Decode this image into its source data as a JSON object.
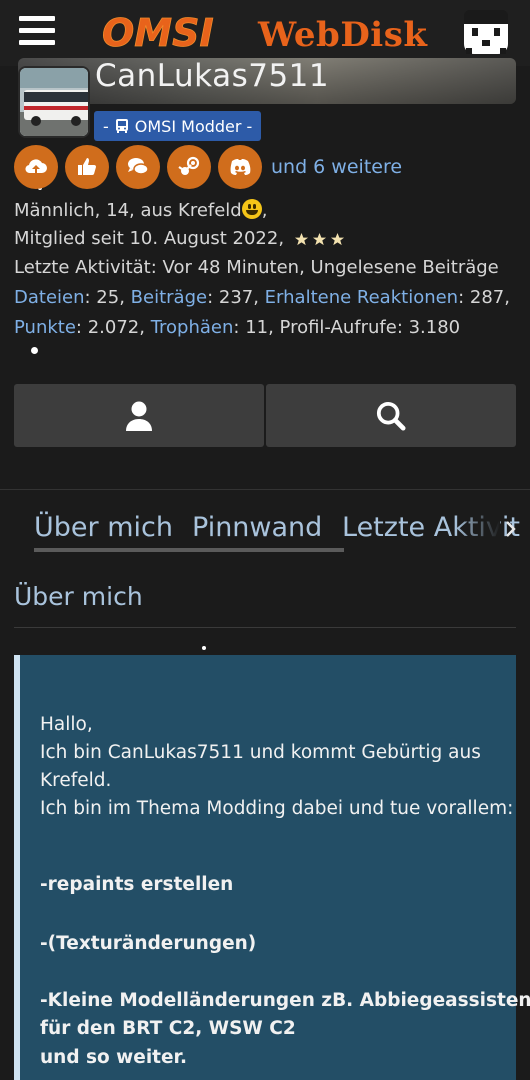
{
  "header": {
    "logo_text_a": "OMSI",
    "logo_text_b": "WebDisk",
    "menu_icon": "hamburger-icon",
    "user_icon": "user-menu-icon"
  },
  "profile": {
    "username": "CanLukas7511",
    "rank": "OMSI Modder",
    "more_trophies": "und 6 weitere",
    "trophy_icons": [
      "upload-icon",
      "thumbs-up-icon",
      "comments-icon",
      "steam-icon",
      "discord-icon"
    ],
    "line1": "Männlich, 14, aus Krefeld",
    "line1_end": ",",
    "member_since": "Mitglied seit 10. August 2022,",
    "last_activity": "Letzte Aktivität: Vor 48 Minuten, Ungelesene Beiträge",
    "stats_row1": {
      "files_label": "Dateien",
      "files_value": ": 25, ",
      "posts_label": "Beiträge",
      "posts_value": ": 237, ",
      "reactions_label": "Erhaltene Reaktionen",
      "reactions_value": ": 287,"
    },
    "stats_row2": {
      "points_label": "Punkte",
      "points_value": ": 2.072, ",
      "trophies_label": "Trophäen",
      "trophies_value": ": 11, Profil-Aufrufe: 3.180"
    }
  },
  "actions": {
    "follow_icon": "user-icon",
    "search_icon": "search-icon"
  },
  "tabs": [
    {
      "label": "Über mich"
    },
    {
      "label": "Pinnwand"
    },
    {
      "label": "Letzte Aktivit"
    }
  ],
  "section": {
    "title": "Über mich"
  },
  "about": {
    "lines": [
      "Hallo,",
      "Ich bin CanLukas7511 und kommt Gebürtig aus",
      "Krefeld.",
      "Ich bin im Thema Modding dabei und tue vorallem:",
      "-repaints erstellen",
      "-(Texturänderungen)",
      "-Kleine Modelländerungen zB. Abbiegeassistent",
      "für den BRT C2, WSW C2",
      "und so weiter."
    ]
  },
  "colors": {
    "background": "#1b1b1b",
    "badge": "#d06d1c",
    "link": "#7fb0e6",
    "rank_badge": "#2d5ba8",
    "about_bg": "#234e66"
  }
}
